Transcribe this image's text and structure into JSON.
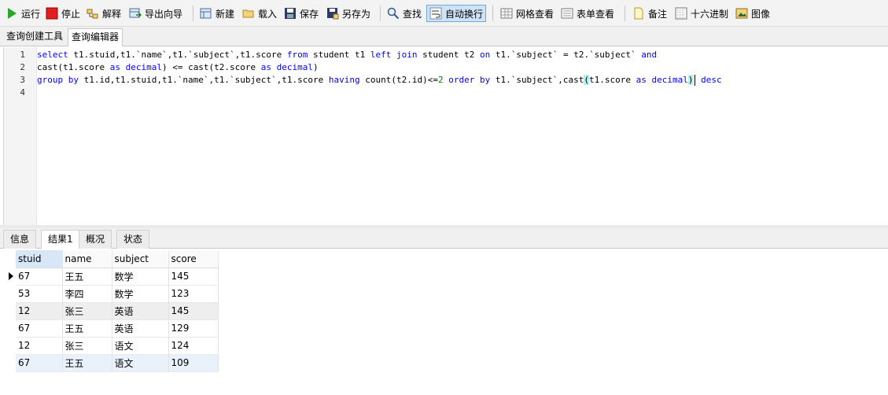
{
  "toolbar": {
    "run": "运行",
    "stop": "停止",
    "explain": "解释",
    "export_wizard": "导出向导",
    "new": "新建",
    "load": "载入",
    "save": "保存",
    "save_as": "另存为",
    "find": "查找",
    "word_wrap": "自动换行",
    "grid_view": "网格查看",
    "form_view": "表单查看",
    "memo": "备注",
    "hex": "十六进制",
    "image": "图像"
  },
  "editor_tabs": [
    "查询创建工具",
    "查询编辑器"
  ],
  "editor": {
    "line_numbers": [
      "1",
      "2",
      "3",
      "4"
    ],
    "line1": {
      "p1": "select",
      "p2": " t1.stuid,t1.`name`,t1.`subject`,t1.score ",
      "p3": "from",
      "p4": " student t1 ",
      "p5": "left join",
      "p6": " student t2 ",
      "p7": "on",
      "p8": " t1.`subject` = t2.`subject` ",
      "p9": "and"
    },
    "line2": {
      "p1": "cast(t1.score ",
      "p2": "as decimal",
      "p3": ") <= cast(t2.score ",
      "p4": "as decimal",
      "p5": ")"
    },
    "line3": {
      "p1": "group by",
      "p2": " t1.id,t1.stuid,t1.`name`,t1.`subject`,t1.score ",
      "p3": "having",
      "p4": " count(t2.id)<=",
      "p5": "2",
      "p6": " ",
      "p7": "order by",
      "p8": " t1.`subject`,cast",
      "p9": "(",
      "p10": "t1.score ",
      "p11": "as decimal",
      "p12": ")",
      "p13": " ",
      "p14": "desc"
    }
  },
  "result_tabs": [
    "信息",
    "结果1",
    "概况",
    "状态"
  ],
  "grid": {
    "columns": [
      "stuid",
      "name",
      "subject",
      "score"
    ],
    "rows": [
      [
        "67",
        "王五",
        "数学",
        "145"
      ],
      [
        "53",
        "李四",
        "数学",
        "123"
      ],
      [
        "12",
        "张三",
        "英语",
        "145"
      ],
      [
        "67",
        "王五",
        "英语",
        "129"
      ],
      [
        "12",
        "张三",
        "语文",
        "124"
      ],
      [
        "67",
        "王五",
        "语文",
        "109"
      ]
    ]
  }
}
